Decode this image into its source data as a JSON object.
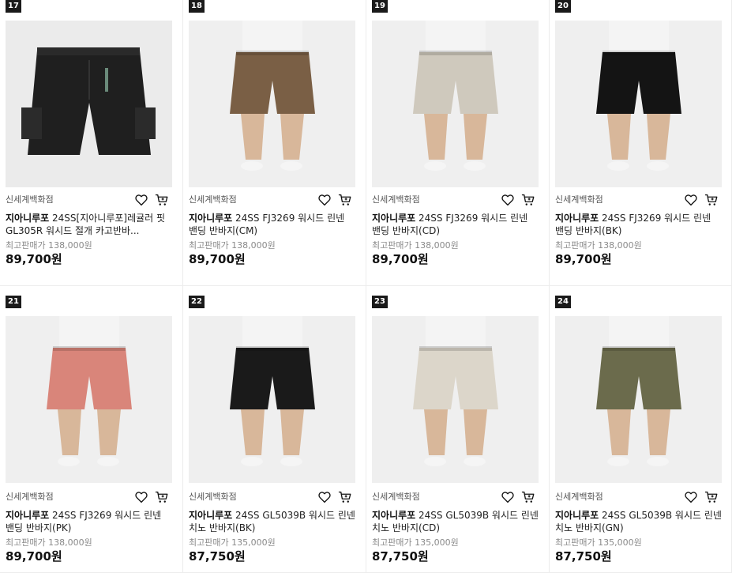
{
  "products": [
    {
      "rank": "17",
      "store": "신세계백화점",
      "brand": "지아니루포",
      "title": "24SS[지아니루포]레귤러 핏 GL305R 워시드 절개 카고반바...",
      "orig_price": "최고판매가 138,000원",
      "price": "89,700원",
      "color": "#1f1f1f",
      "style": "cargo"
    },
    {
      "rank": "18",
      "store": "신세계백화점",
      "brand": "지아니루포",
      "title": "24SS FJ3269 워시드 린넨 밴딩 반바지(CM)",
      "orig_price": "최고판매가 138,000원",
      "price": "89,700원",
      "color": "#7a5f45",
      "style": "model"
    },
    {
      "rank": "19",
      "store": "신세계백화점",
      "brand": "지아니루포",
      "title": "24SS FJ3269 워시드 린넨 밴딩 반바지(CD)",
      "orig_price": "최고판매가 138,000원",
      "price": "89,700원",
      "color": "#cfc9bd",
      "style": "model"
    },
    {
      "rank": "20",
      "store": "신세계백화점",
      "brand": "지아니루포",
      "title": "24SS FJ3269 워시드 린넨 밴딩 반바지(BK)",
      "orig_price": "최고판매가 138,000원",
      "price": "89,700원",
      "color": "#141414",
      "style": "model"
    },
    {
      "rank": "21",
      "store": "신세계백화점",
      "brand": "지아니루포",
      "title": "24SS FJ3269 워시드 린넨 밴딩 반바지(PK)",
      "orig_price": "최고판매가 138,000원",
      "price": "89,700원",
      "color": "#d9857a",
      "style": "model"
    },
    {
      "rank": "22",
      "store": "신세계백화점",
      "brand": "지아니루포",
      "title": "24SS GL5039B 워시드 린넨 치노 반바지(BK)",
      "orig_price": "최고판매가 135,000원",
      "price": "87,750원",
      "color": "#1a1a1a",
      "style": "model"
    },
    {
      "rank": "23",
      "store": "신세계백화점",
      "brand": "지아니루포",
      "title": "24SS GL5039B 워시드 린넨 치노 반바지(CD)",
      "orig_price": "최고판매가 135,000원",
      "price": "87,750원",
      "color": "#dcd6ca",
      "style": "model"
    },
    {
      "rank": "24",
      "store": "신세계백화점",
      "brand": "지아니루포",
      "title": "24SS GL5039B 워시드 린넨 치노 반바지(GN)",
      "orig_price": "최고판매가 135,000원",
      "price": "87,750원",
      "color": "#6b6b4c",
      "style": "model"
    }
  ],
  "icons": {
    "wish": "heart-icon",
    "cart": "cart-icon"
  }
}
